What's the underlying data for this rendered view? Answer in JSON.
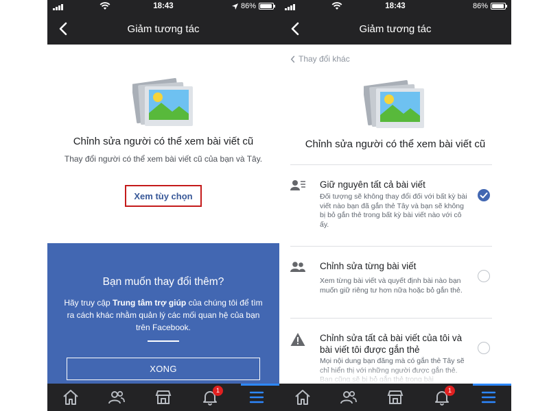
{
  "colors": {
    "bar_bg": "#232325",
    "fb_blue": "#4267b2",
    "link_blue": "#385898",
    "highlight_red": "#c41a1a",
    "badge_red": "#e02020",
    "tab_active": "#2d88ff"
  },
  "left": {
    "status": {
      "time": "18:43",
      "battery": "86%"
    },
    "header": {
      "title": "Giảm tương tác",
      "back_icon": "chevron-left-icon"
    },
    "main": {
      "illustration_icon": "photo-stack-icon",
      "heading": "Chỉnh sửa người có thể xem bài viết cũ",
      "description": "Thay đổi người có thể xem bài viết cũ của bạn và Tây.",
      "options_button": "Xem tùy chọn"
    },
    "help_panel": {
      "title": "Bạn muốn thay đổi thêm?",
      "desc_before": "Hãy truy cập ",
      "desc_link": "Trung tâm trợ giúp",
      "desc_after": " của chúng tôi để tìm ra cách khác nhằm quản lý các mối quan hệ của bạn trên Facebook.",
      "done_button": "XONG"
    },
    "tabs": [
      "home-icon",
      "friends-icon",
      "marketplace-icon",
      "notifications-icon",
      "menu-icon"
    ],
    "notification_badge": "1",
    "active_tab": "menu-icon"
  },
  "right": {
    "status": {
      "time": "18:43",
      "battery": "86%"
    },
    "header": {
      "title": "Giảm tương tác",
      "back_icon": "chevron-left-icon"
    },
    "back_link": "Thay đổi khác",
    "heading": "Chỉnh sửa người có thể xem bài viết cũ",
    "options": [
      {
        "title": "Giữ nguyên tất cả bài viết",
        "description": "Đối tượng sẽ không thay đổi đối với bất kỳ bài viết nào bạn đã gắn thẻ Tây và bạn sẽ không bị bỏ gắn thẻ trong bất kỳ bài viết nào với cô ấy.",
        "icon": "person-list-icon",
        "selected": true
      },
      {
        "title": "Chỉnh sửa từng bài viết",
        "description": "Xem từng bài viết và quyết định bài nào bạn muốn giữ riêng tư hơn nữa hoặc bỏ gắn thẻ.",
        "icon": "people-icon",
        "selected": false
      },
      {
        "title": "Chỉnh sửa tất cả bài viết của tôi và bài viết tôi được gắn thẻ",
        "description": "Mọi nội dung bạn đăng mà có gắn thẻ Tây sẽ chỉ hiển thị với những người được gắn thẻ. Bạn cũng sẽ bị bỏ gắn thẻ trong bài",
        "icon": "warning-icon",
        "selected": false
      }
    ],
    "tabs": [
      "home-icon",
      "friends-icon",
      "marketplace-icon",
      "notifications-icon",
      "menu-icon"
    ],
    "notification_badge": "1",
    "active_tab": "menu-icon"
  }
}
